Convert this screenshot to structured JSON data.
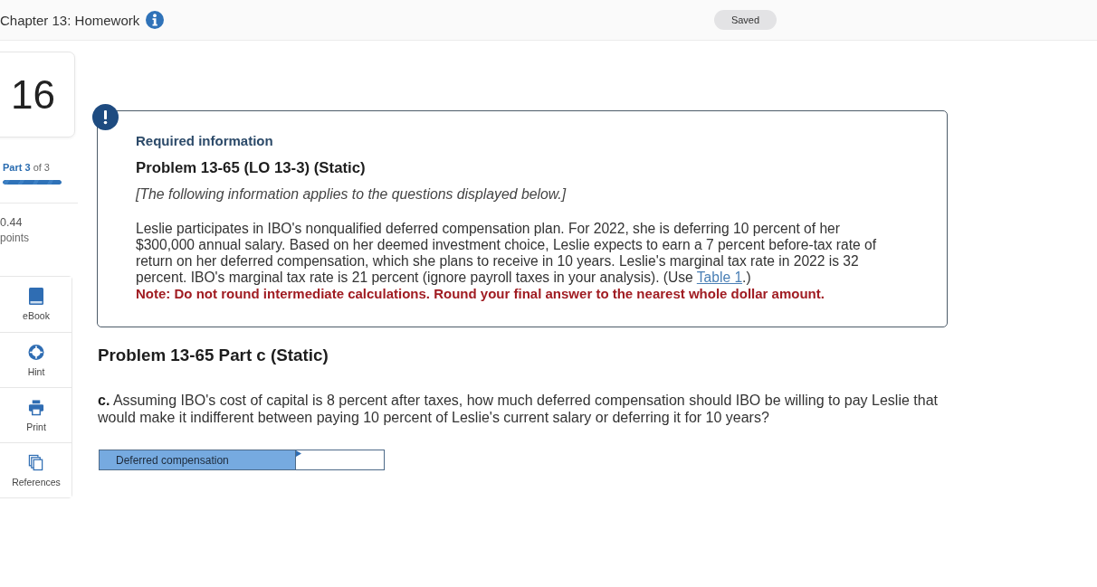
{
  "header": {
    "title": "Chapter 13: Homework",
    "status": "Saved"
  },
  "sidebar": {
    "question_number": "16",
    "part": {
      "label": "**Part 3** of 3",
      "level": 1
    },
    "score": "0.44",
    "score_unit": "points",
    "tools": [
      {
        "label": "eBook",
        "kind": "ebook"
      },
      {
        "label": "Hint",
        "kind": "hint"
      },
      {
        "label": "Print",
        "kind": "print"
      },
      {
        "label": "References",
        "kind": "references"
      }
    ]
  },
  "info_box": {
    "heading": "Required information",
    "title": "Problem 13-65 (LO 13-3) (Static)",
    "intro": "[The following information applies to the questions displayed below.]",
    "body": "Leslie participates in IBO's nonqualified deferred compensation plan. For 2022, she is deferring 10 percent of her $300,000 annual salary. Based on her deemed investment choice, Leslie expects to earn a 7 percent before-tax rate of return on her deferred compensation, which she plans to receive in 10 years. Leslie's marginal tax rate in 2022 is 32 percent. IBO's marginal tax rate is 21 percent (ignore payroll taxes in your analysis). (Use ",
    "link": "Table 1",
    "body_end": ".)",
    "note": "Note: Do not round intermediate calculations. Round your final answer to the nearest whole dollar amount."
  },
  "question": {
    "title": "Problem 13-65 Part c (Static)",
    "text": "**c.** Assuming IBO's cost of capital is 8 percent after taxes, how much deferred compensation should IBO be willing to pay Leslie that would make it indifferent between paying 10 percent of Leslie's current salary or deferring it for 10 years?",
    "answer": {
      "label": "Deferred compensation"
    }
  }
}
